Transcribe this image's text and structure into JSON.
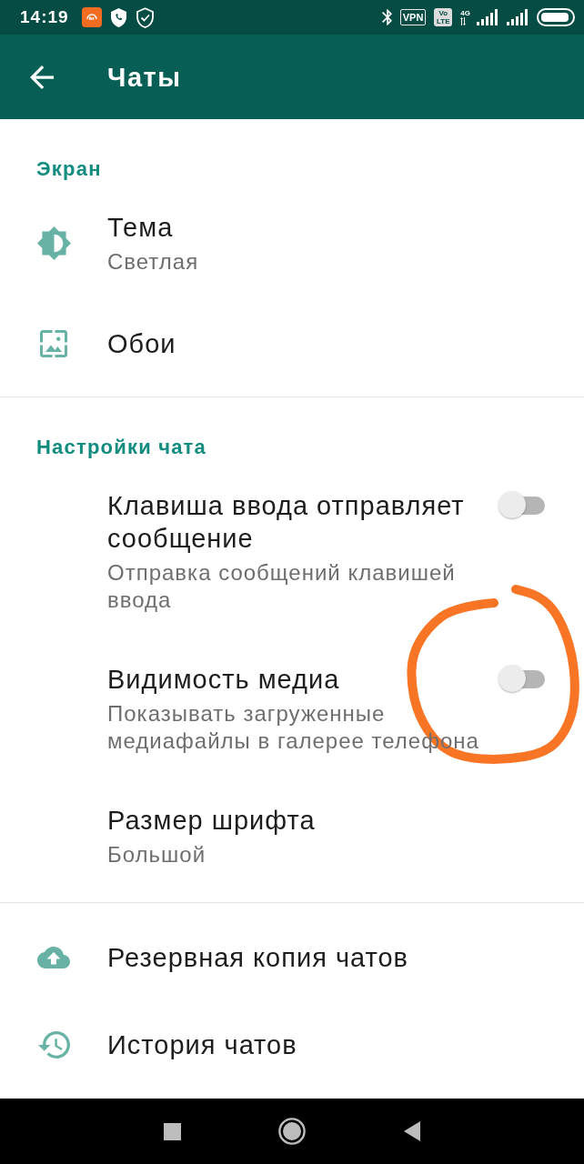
{
  "status_bar": {
    "time": "14:19",
    "vpn": "VPN",
    "volte": "Vo LTE",
    "network_type": "4G"
  },
  "app_bar": {
    "title": "Чаты"
  },
  "sections": [
    {
      "title": "Экран",
      "items": [
        {
          "kind": "icon",
          "title": "Тема",
          "subtitle": "Светлая"
        },
        {
          "kind": "icon",
          "title": "Обои"
        }
      ]
    },
    {
      "title": "Настройки чата",
      "items": [
        {
          "kind": "toggle",
          "title": "Клавиша ввода отправляет сообщение",
          "subtitle": "Отправка сообщений клавишей ввода",
          "on": false
        },
        {
          "kind": "toggle",
          "title": "Видимость медиа",
          "subtitle": "Показывать загруженные медиафайлы в галерее телефона",
          "on": false
        },
        {
          "kind": "text",
          "title": "Размер шрифта",
          "subtitle": "Большой"
        }
      ]
    },
    {
      "items": [
        {
          "kind": "icon",
          "title": "Резервная копия чатов"
        },
        {
          "kind": "icon",
          "title": "История чатов"
        }
      ]
    }
  ]
}
